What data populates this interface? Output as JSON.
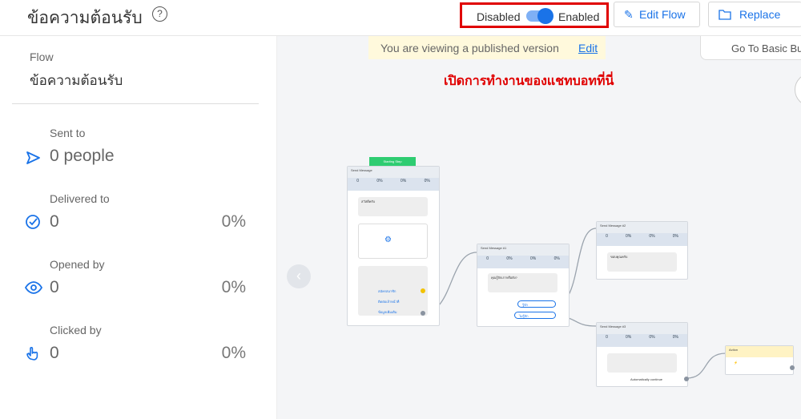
{
  "header": {
    "title": "ข้อความต้อนรับ",
    "help_icon": "?",
    "toggle": {
      "disabled_label": "Disabled",
      "enabled_label": "Enabled",
      "state": "enabled"
    },
    "edit_flow_label": "Edit Flow",
    "replace_label": "Replace"
  },
  "sidebar": {
    "flow_label": "Flow",
    "flow_name": "ข้อความต้อนรับ",
    "stats": [
      {
        "label": "Sent to",
        "value": "0 people",
        "pct": ""
      },
      {
        "label": "Delivered to",
        "value": "0",
        "pct": "0%"
      },
      {
        "label": "Opened by",
        "value": "0",
        "pct": "0%"
      },
      {
        "label": "Clicked by",
        "value": "0",
        "pct": "0%"
      }
    ]
  },
  "canvas": {
    "banner_text": "You are viewing a published version",
    "banner_edit": "Edit",
    "basic_builder": "Go To Basic Bui",
    "red_note": "เปิดการทำงานของแชทบอทที่นี่",
    "start_tag": "Starting Step",
    "node1": {
      "title": "Send Message",
      "stats": [
        "0",
        "0%",
        "0%",
        "0%"
      ],
      "text1": "สวัสดีครับ",
      "buttons": [
        "สมัครสมาชิก",
        "ติดต่อเจ้าหน้าที่",
        "ข้อมูลเพิ่มเติม"
      ]
    },
    "node2": {
      "title": "Send Message #1",
      "stats": [
        "0",
        "0%",
        "0%",
        "0%"
      ],
      "text": "คุณรู้จักเราหรือยัง?",
      "buttons": [
        "รู้จัก",
        "ไม่รู้จัก"
      ]
    },
    "node3": {
      "title": "Send Message #2",
      "stats": [
        "0",
        "0%",
        "0%",
        "0%"
      ],
      "text": "ขอบคุณครับ"
    },
    "node4": {
      "title": "Send Message #3",
      "stats": [
        "0",
        "0%",
        "0%",
        "0%"
      ],
      "footer": "Automatically continue"
    },
    "node5": {
      "title": "Action"
    }
  }
}
